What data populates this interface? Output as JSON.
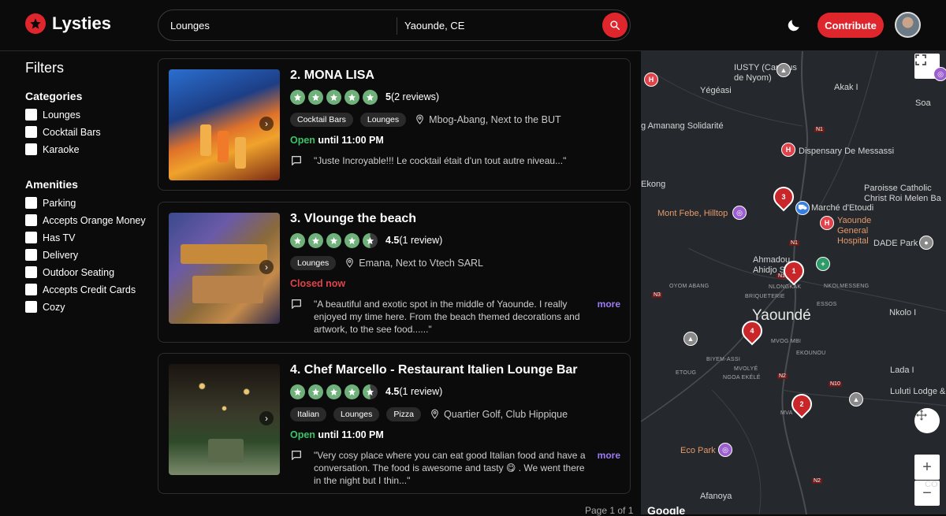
{
  "header": {
    "logo_text": "Lysties",
    "search_query": "Lounges",
    "search_location": "Yaounde, CE",
    "contribute_label": "Contribute"
  },
  "filters": {
    "title": "Filters",
    "categories_title": "Categories",
    "categories": [
      "Lounges",
      "Cocktail Bars",
      "Karaoke"
    ],
    "amenities_title": "Amenities",
    "amenities": [
      "Parking",
      "Accepts Orange Money",
      "Has TV",
      "Delivery",
      "Outdoor Seating",
      "Accepts Credit Cards",
      "Cozy"
    ]
  },
  "results": [
    {
      "title": "2. MONA LISA",
      "rating": 5,
      "rating_value": "5",
      "reviews": "(2 reviews)",
      "tags": [
        "Cocktail Bars",
        "Lounges"
      ],
      "location": "Mbog-Abang, Next to the BUT",
      "status_open": "Open",
      "status_until": " until 11:00 PM",
      "status_closed": "",
      "review": "\"Juste Incroyable!!! Le cocktail était d'un tout autre niveau...\"",
      "more": ""
    },
    {
      "title": "3. Vlounge the beach",
      "rating": 4.5,
      "rating_value": "4.5",
      "reviews": "(1 review)",
      "tags": [
        "Lounges"
      ],
      "location": "Emana, Next to Vtech SARL",
      "status_open": "",
      "status_until": "",
      "status_closed": "Closed now",
      "review": "\"A beautiful and exotic spot in the middle of Yaounde. I really enjoyed my time here. From the beach themed decorations and artwork, to the see food......\"",
      "more": "more"
    },
    {
      "title": "4. Chef Marcello - Restaurant Italien Lounge Bar",
      "rating": 4.5,
      "rating_value": "4.5",
      "reviews": "(1 review)",
      "tags": [
        "Italian",
        "Lounges",
        "Pizza"
      ],
      "location": "Quartier Golf, Club Hippique",
      "status_open": "Open",
      "status_until": " until 11:00 PM",
      "status_closed": "",
      "review": "\"Very cosy place where you can eat good Italian food and have a conversation. The food is awesome and tasty 😋 . We went there in the night but I thin...\"",
      "more": "more"
    }
  ],
  "pager": "Page 1 of 1",
  "map": {
    "labels": {
      "iusty": "IUSTY (Campus de Nyom)",
      "yegeasi": "Yégéasi",
      "akak": "Akak I",
      "soa": "Soa",
      "amanang": "g Amanang Solidarité",
      "dispensary": "Dispensary De Messassi",
      "ekong": "Ekong",
      "paroisse": "Paroisse Catholic Christ Roi Melen Ba",
      "montfebe": "Mont Febe, Hilltop",
      "marche": "Marché d'Etoudi",
      "hospital": "Yaounde General Hospital",
      "dade": "DADE Park",
      "ahmadou": "Ahmadou Ahidjo S",
      "yaounde": "Yaoundé",
      "nkolo": "Nkolo I",
      "lada": "Lada I",
      "luluti": "Luluti Lodge &",
      "ecopark": "Eco Park",
      "afanoya": "Afanoya",
      "oyom": "OYOM ABANG",
      "nlongkak": "NLONGKAK",
      "nkolmesseng": "NKOLMESSENG",
      "briqueterie": "BRIQUETERIE",
      "essos": "ESSOS",
      "mvog": "MVOG MBI",
      "ekounou": "EKOUNOU",
      "biyem": "BIYEM-ASSI",
      "etoug": "ETOUG",
      "mvolye": "MVOLYÉ",
      "ngoa": "NGOA EKÉLÉ",
      "mva": "MVA",
      "co": "CO"
    },
    "markers": [
      "1",
      "2",
      "3",
      "4"
    ],
    "roads": [
      "N1",
      "N1",
      "N1",
      "N3",
      "N2",
      "N10",
      "N2"
    ],
    "attribution": "Google"
  }
}
